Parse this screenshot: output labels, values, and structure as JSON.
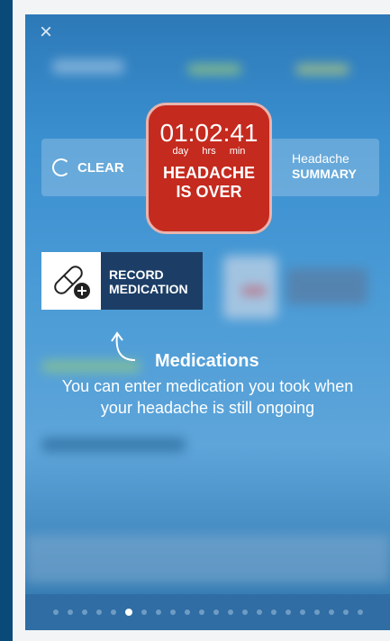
{
  "screen": {
    "close_label": "×",
    "clear": {
      "label": "CLEAR"
    },
    "summary": {
      "line1": "Headache",
      "line2": "SUMMARY"
    },
    "timer": {
      "value": "01:02:41",
      "units": [
        "day",
        "hrs",
        "min"
      ],
      "status_line1": "HEADACHE",
      "status_line2": "IS OVER"
    },
    "record": {
      "line1": "RECORD",
      "line2": "MEDICATION",
      "icon": "pill-plus-icon"
    },
    "tip": {
      "title": "Medications",
      "line1": "You can enter medication you took when",
      "line2": "your headache is still ongoing"
    },
    "pager": {
      "count": 22,
      "active": 5
    }
  },
  "colors": {
    "sidebar": "#0a4a78",
    "red_card": "#c52a1e",
    "record_bg": "#1c3e66"
  }
}
